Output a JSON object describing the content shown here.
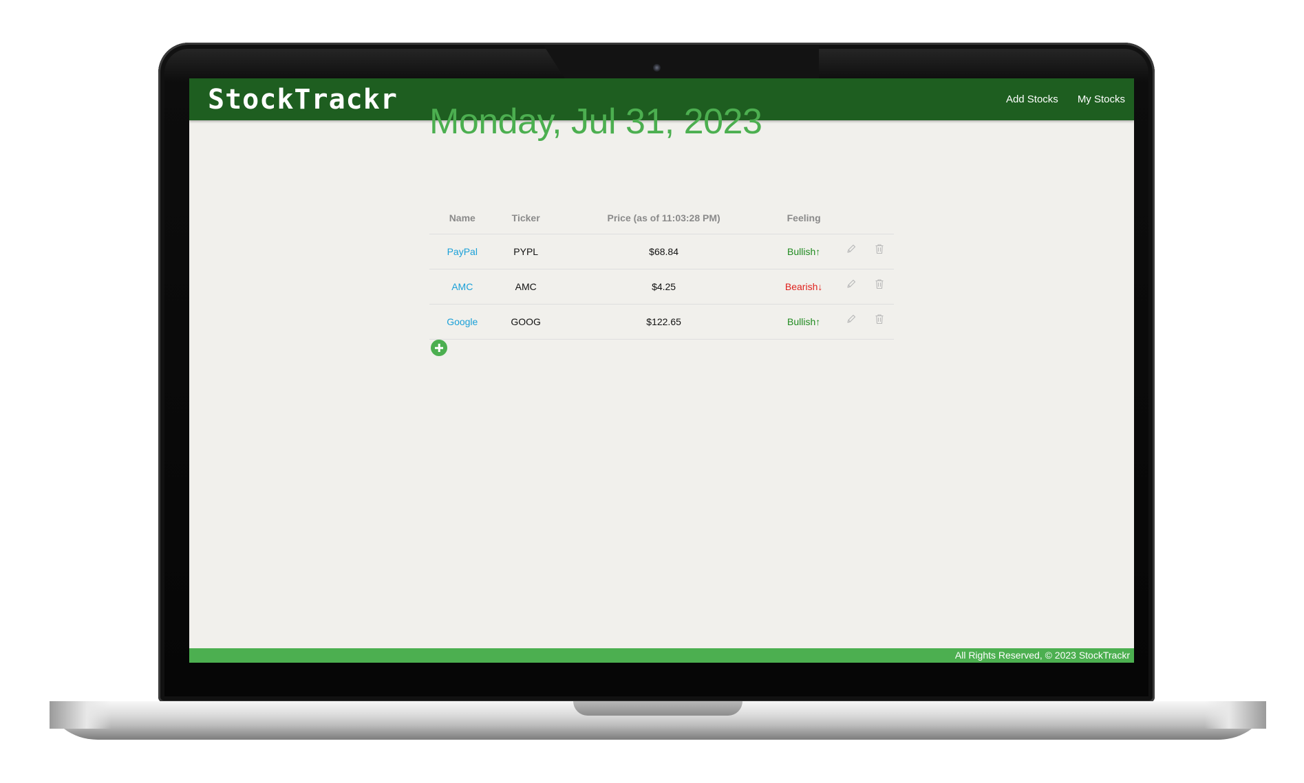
{
  "app": {
    "brand": "StockTrackr"
  },
  "nav": {
    "links": [
      {
        "label": "Add Stocks"
      },
      {
        "label": "My Stocks"
      }
    ]
  },
  "main": {
    "date_title": "Monday, Jul 31, 2023"
  },
  "table": {
    "headers": {
      "name": "Name",
      "ticker": "Ticker",
      "price": "Price (as of 11:03:28 PM)",
      "feeling": "Feeling"
    },
    "rows": [
      {
        "name": "PayPal",
        "ticker": "PYPL",
        "price": "$68.84",
        "feeling": "Bullish↑",
        "sentiment": "bullish"
      },
      {
        "name": "AMC",
        "ticker": "AMC",
        "price": "$4.25",
        "feeling": "Bearish↓",
        "sentiment": "bearish"
      },
      {
        "name": "Google",
        "ticker": "GOOG",
        "price": "$122.65",
        "feeling": "Bullish↑",
        "sentiment": "bullish"
      }
    ],
    "row_icons": {
      "edit": "pencil-icon",
      "delete": "trash-icon"
    }
  },
  "add_button": {
    "icon": "plus-circle-icon"
  },
  "footer": {
    "text": "All Rights Reserved, © 2023 StockTrackr"
  },
  "colors": {
    "navbar": "#1e5e20",
    "accent": "#4caf50",
    "bullish": "#1e8a1e",
    "bearish": "#e0201c",
    "link": "#1aa0d8",
    "page_bg": "#f1f0ec"
  }
}
